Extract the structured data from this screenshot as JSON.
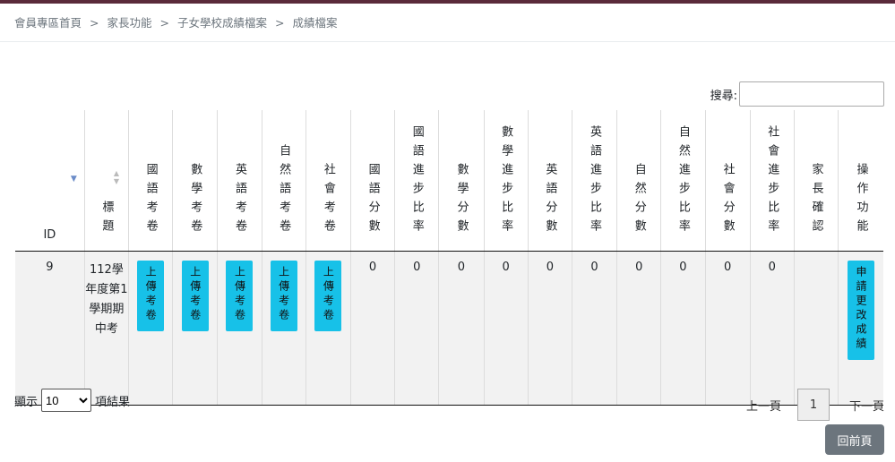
{
  "breadcrumb": [
    "會員專區首頁",
    "家長功能",
    "子女學校成績檔案",
    "成績檔案"
  ],
  "breadcrumb_separator": ">",
  "search": {
    "label": "搜尋:",
    "value": ""
  },
  "table": {
    "columns": [
      "ID",
      "標題",
      "國語考卷",
      "數學考卷",
      "英語考卷",
      "自然語考卷",
      "社會考卷",
      "國語分數",
      "國語進步比率",
      "數學分數",
      "數學進步比率",
      "英語分數",
      "英語進步比率",
      "自然分數",
      "自然進步比率",
      "社會分數",
      "社會進步比率",
      "家長確認",
      "操作功能"
    ],
    "row": {
      "id": "9",
      "title": "112學年度第1學期期中考",
      "upload_label": "上傳考卷",
      "scores": [
        "0",
        "0",
        "0",
        "0",
        "0",
        "0",
        "0",
        "0",
        "0",
        "0"
      ],
      "parent_confirm": "",
      "action_label": "申請更改成績"
    }
  },
  "length": {
    "prefix": "顯示",
    "selected": "10",
    "suffix": "項結果"
  },
  "pager": {
    "prev": "上一頁",
    "current": "1",
    "next": "下一頁"
  },
  "back_label": "回前頁",
  "colors": {
    "accent": "#17c1e8",
    "secondary": "#6c757d"
  }
}
